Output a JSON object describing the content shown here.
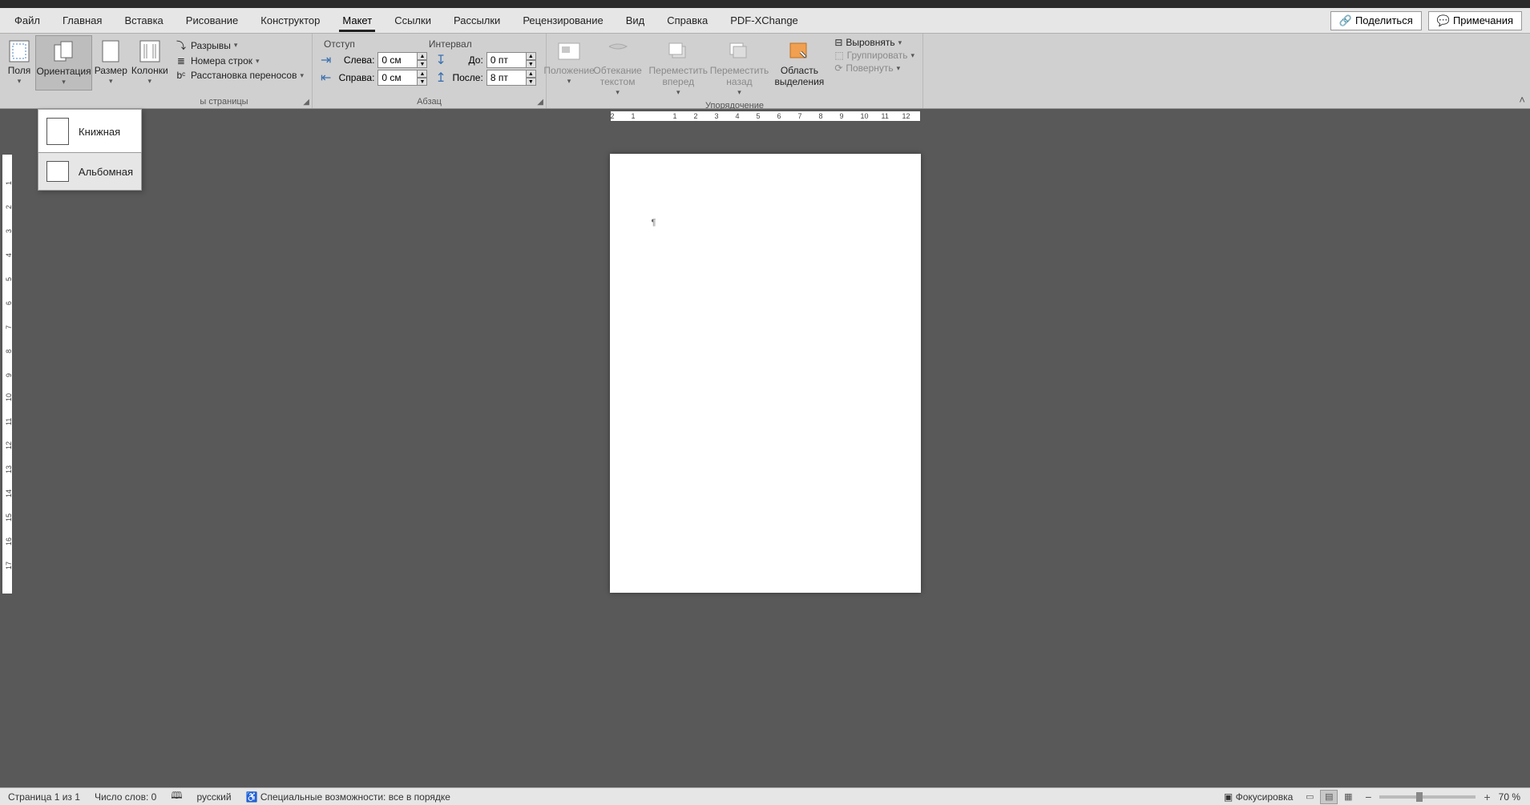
{
  "menubar": {
    "items": [
      "Файл",
      "Главная",
      "Вставка",
      "Рисование",
      "Конструктор",
      "Макет",
      "Ссылки",
      "Рассылки",
      "Рецензирование",
      "Вид",
      "Справка",
      "PDF-XChange"
    ],
    "active_index": 5,
    "share": "Поделиться",
    "comments": "Примечания"
  },
  "ribbon": {
    "page_setup": {
      "margins": "Поля",
      "orientation": "Ориентация",
      "size": "Размер",
      "columns": "Колонки",
      "breaks": "Разрывы",
      "line_numbers": "Номера строк",
      "hyphenation": "Расстановка переносов",
      "group_label_partial": "ы страницы"
    },
    "paragraph": {
      "indent_header": "Отступ",
      "spacing_header": "Интервал",
      "left": "Слева:",
      "right": "Справа:",
      "before": "До:",
      "after": "После:",
      "left_val": "0 см",
      "right_val": "0 см",
      "before_val": "0 пт",
      "after_val": "8 пт",
      "group_label": "Абзац"
    },
    "arrange": {
      "position": "Положение",
      "wrap": "Обтекание текстом",
      "forward": "Переместить вперед",
      "backward": "Переместить назад",
      "selection_pane": "Область выделения",
      "align": "Выровнять",
      "group": "Группировать",
      "rotate": "Повернуть",
      "group_label": "Упорядочение"
    }
  },
  "orientation_menu": {
    "portrait": "Книжная",
    "landscape": "Альбомная"
  },
  "hruler": [
    "2",
    "1",
    "",
    "1",
    "2",
    "3",
    "4",
    "5",
    "6",
    "7",
    "8",
    "9",
    "10",
    "11",
    "12"
  ],
  "vruler": [
    "",
    "1",
    "2",
    "3",
    "4",
    "5",
    "6",
    "7",
    "8",
    "9",
    "10",
    "11",
    "12",
    "13",
    "14",
    "15",
    "16",
    "17"
  ],
  "statusbar": {
    "page": "Страница 1 из 1",
    "words": "Число слов: 0",
    "language": "русский",
    "accessibility": "Специальные возможности: все в порядке",
    "focus": "Фокусировка",
    "zoom": "70 %"
  }
}
